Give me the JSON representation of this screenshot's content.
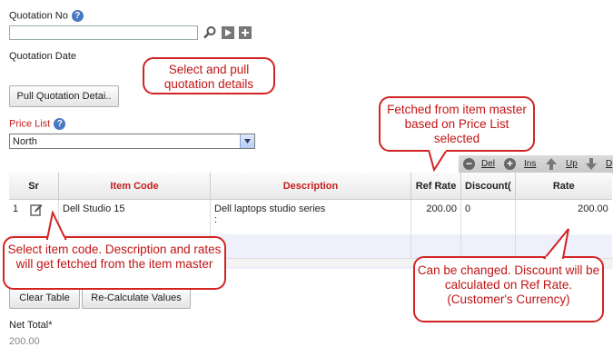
{
  "form": {
    "quotation_no_label": "Quotation No",
    "quotation_no_value": "",
    "quotation_date_label": "Quotation Date",
    "pull_button": "Pull Quotation Detai..",
    "price_list_label": "Price List",
    "price_list_value": "North"
  },
  "toolbar": {
    "del": "Del",
    "ins": "Ins",
    "up": "Up",
    "down": "D"
  },
  "table": {
    "headers": [
      "Sr",
      "Item Code",
      "Description",
      "Ref Rate",
      "Discount(",
      "Rate"
    ],
    "rows": [
      {
        "sr": "1",
        "item_code": "Dell Studio 15",
        "description": "Dell laptops studio series",
        "description_extra": ":",
        "ref_rate": "200.00",
        "discount": "0",
        "rate": "200.00"
      }
    ]
  },
  "buttons": {
    "clear_table": "Clear Table",
    "recalculate": "Re-Calculate Values"
  },
  "totals": {
    "net_total_label": "Net Total*",
    "net_total_value": "200.00"
  },
  "callouts": {
    "pull": "Select and pull quotation details",
    "fetched": "Fetched from item master based on Price List selected",
    "item_code": "Select item code. Description and rates will get fetched from the item master",
    "discount": "Can be changed.  Discount will be calculated on Ref Rate. (Customer's Currency)"
  },
  "colors": {
    "accent_red": "#c41f1f",
    "help_blue": "#4a78c2",
    "callout_border": "#d42323"
  }
}
